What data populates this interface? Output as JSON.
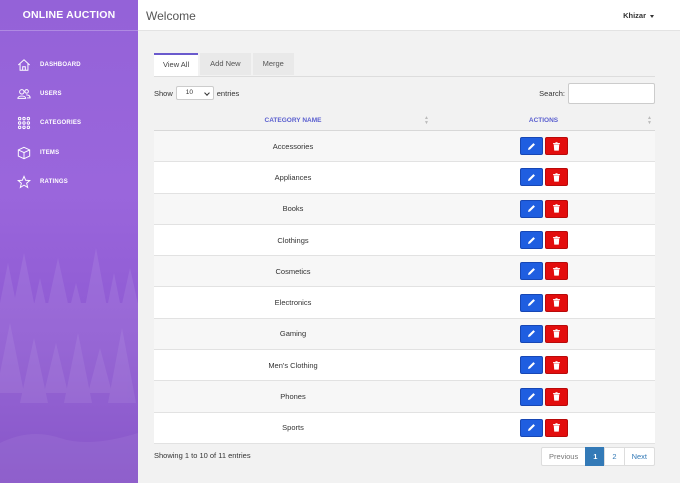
{
  "sidebar": {
    "brand": "ONLINE AUCTION",
    "items": [
      {
        "label": "DASHBOARD",
        "icon": "home-icon"
      },
      {
        "label": "USERS",
        "icon": "users-icon"
      },
      {
        "label": "CATEGORIES",
        "icon": "grid-icon"
      },
      {
        "label": "ITEMS",
        "icon": "box-icon"
      },
      {
        "label": "RATINGS",
        "icon": "star-icon"
      }
    ]
  },
  "topbar": {
    "title": "Welcome",
    "user": "Khizar"
  },
  "tabs": [
    "View All",
    "Add New",
    "Merge"
  ],
  "controls": {
    "show_label": "Show",
    "entries_value": "10",
    "entries_label": "entries",
    "search_label": "Search:",
    "search_value": ""
  },
  "table": {
    "headers": [
      "CATEGORY NAME",
      "ACTIONS"
    ],
    "rows": [
      "Accessories",
      "Appliances",
      "Books",
      "Clothings",
      "Cosmetics",
      "Electronics",
      "Gaming",
      "Men's Clothing",
      "Phones",
      "Sports"
    ]
  },
  "footer": {
    "info": "Showing 1 to 10 of 11 entries",
    "pager": {
      "previous": "Previous",
      "pages": [
        "1",
        "2"
      ],
      "current": "1",
      "next": "Next"
    }
  },
  "colors": {
    "accent": "#6a5acd",
    "edit": "#1f5ee0",
    "delete": "#e30d0d",
    "page_active": "#337ab7"
  }
}
